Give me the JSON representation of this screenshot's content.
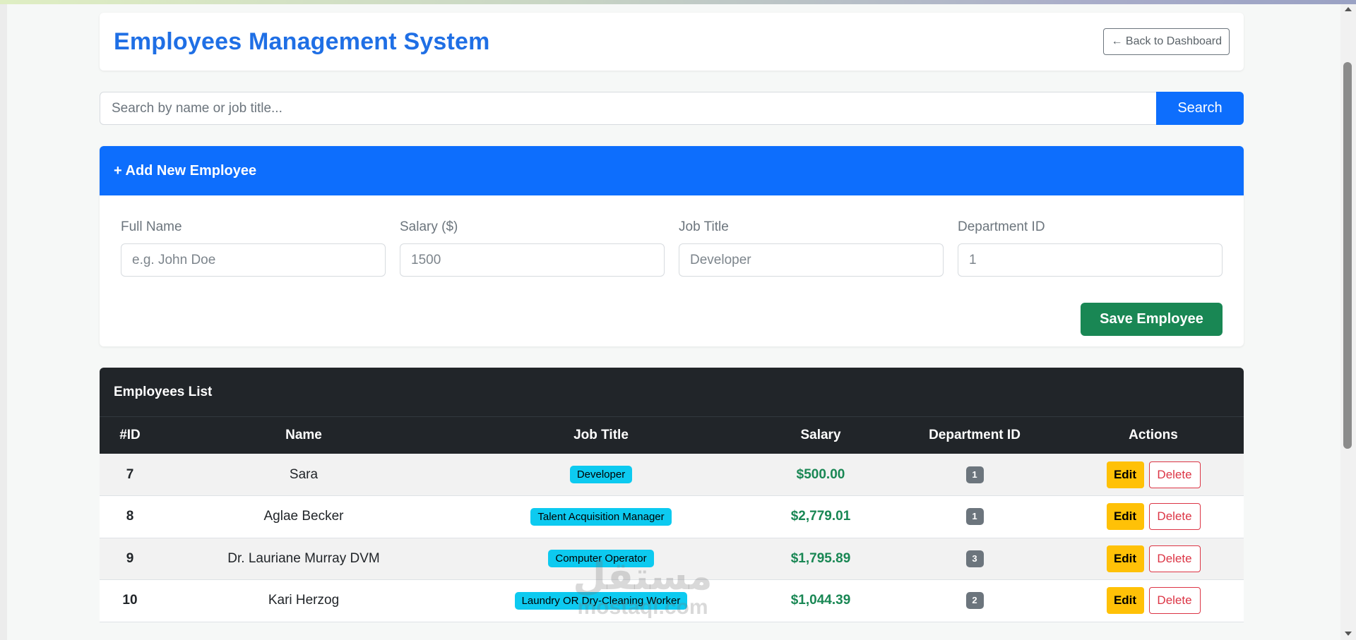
{
  "header": {
    "title": "Employees Management System",
    "back_label": "← Back to Dashboard"
  },
  "search": {
    "placeholder": "Search by name or job title...",
    "button_label": "Search"
  },
  "add_form": {
    "title": "+ Add New Employee",
    "fields": [
      {
        "label": "Full Name",
        "placeholder": "e.g. John Doe"
      },
      {
        "label": "Salary ($)",
        "placeholder": "1500"
      },
      {
        "label": "Job Title",
        "placeholder": "Developer"
      },
      {
        "label": "Department ID",
        "placeholder": "1"
      }
    ],
    "save_label": "Save Employee"
  },
  "employees": {
    "title": "Employees List",
    "columns": [
      "#ID",
      "Name",
      "Job Title",
      "Salary",
      "Department ID",
      "Actions"
    ],
    "rows": [
      {
        "id": "7",
        "name": "Sara",
        "job": "Developer",
        "salary": "$500.00",
        "dept": "1"
      },
      {
        "id": "8",
        "name": "Aglae Becker",
        "job": "Talent Acquisition Manager",
        "salary": "$2,779.01",
        "dept": "1"
      },
      {
        "id": "9",
        "name": "Dr. Lauriane Murray DVM",
        "job": "Computer Operator",
        "salary": "$1,795.89",
        "dept": "3"
      },
      {
        "id": "10",
        "name": "Kari Herzog",
        "job": "Laundry OR Dry-Cleaning Worker",
        "salary": "$1,044.39",
        "dept": "2"
      }
    ],
    "edit_label": "Edit",
    "delete_label": "Delete"
  },
  "watermark": {
    "top": "مستقل",
    "bottom": "mostaql.com"
  },
  "colors": {
    "primary": "#0d6efd",
    "success": "#198754",
    "warning": "#ffc107",
    "danger": "#dc3545",
    "info": "#0dcaf0",
    "dark": "#212529",
    "title": "#1f6fe5"
  }
}
